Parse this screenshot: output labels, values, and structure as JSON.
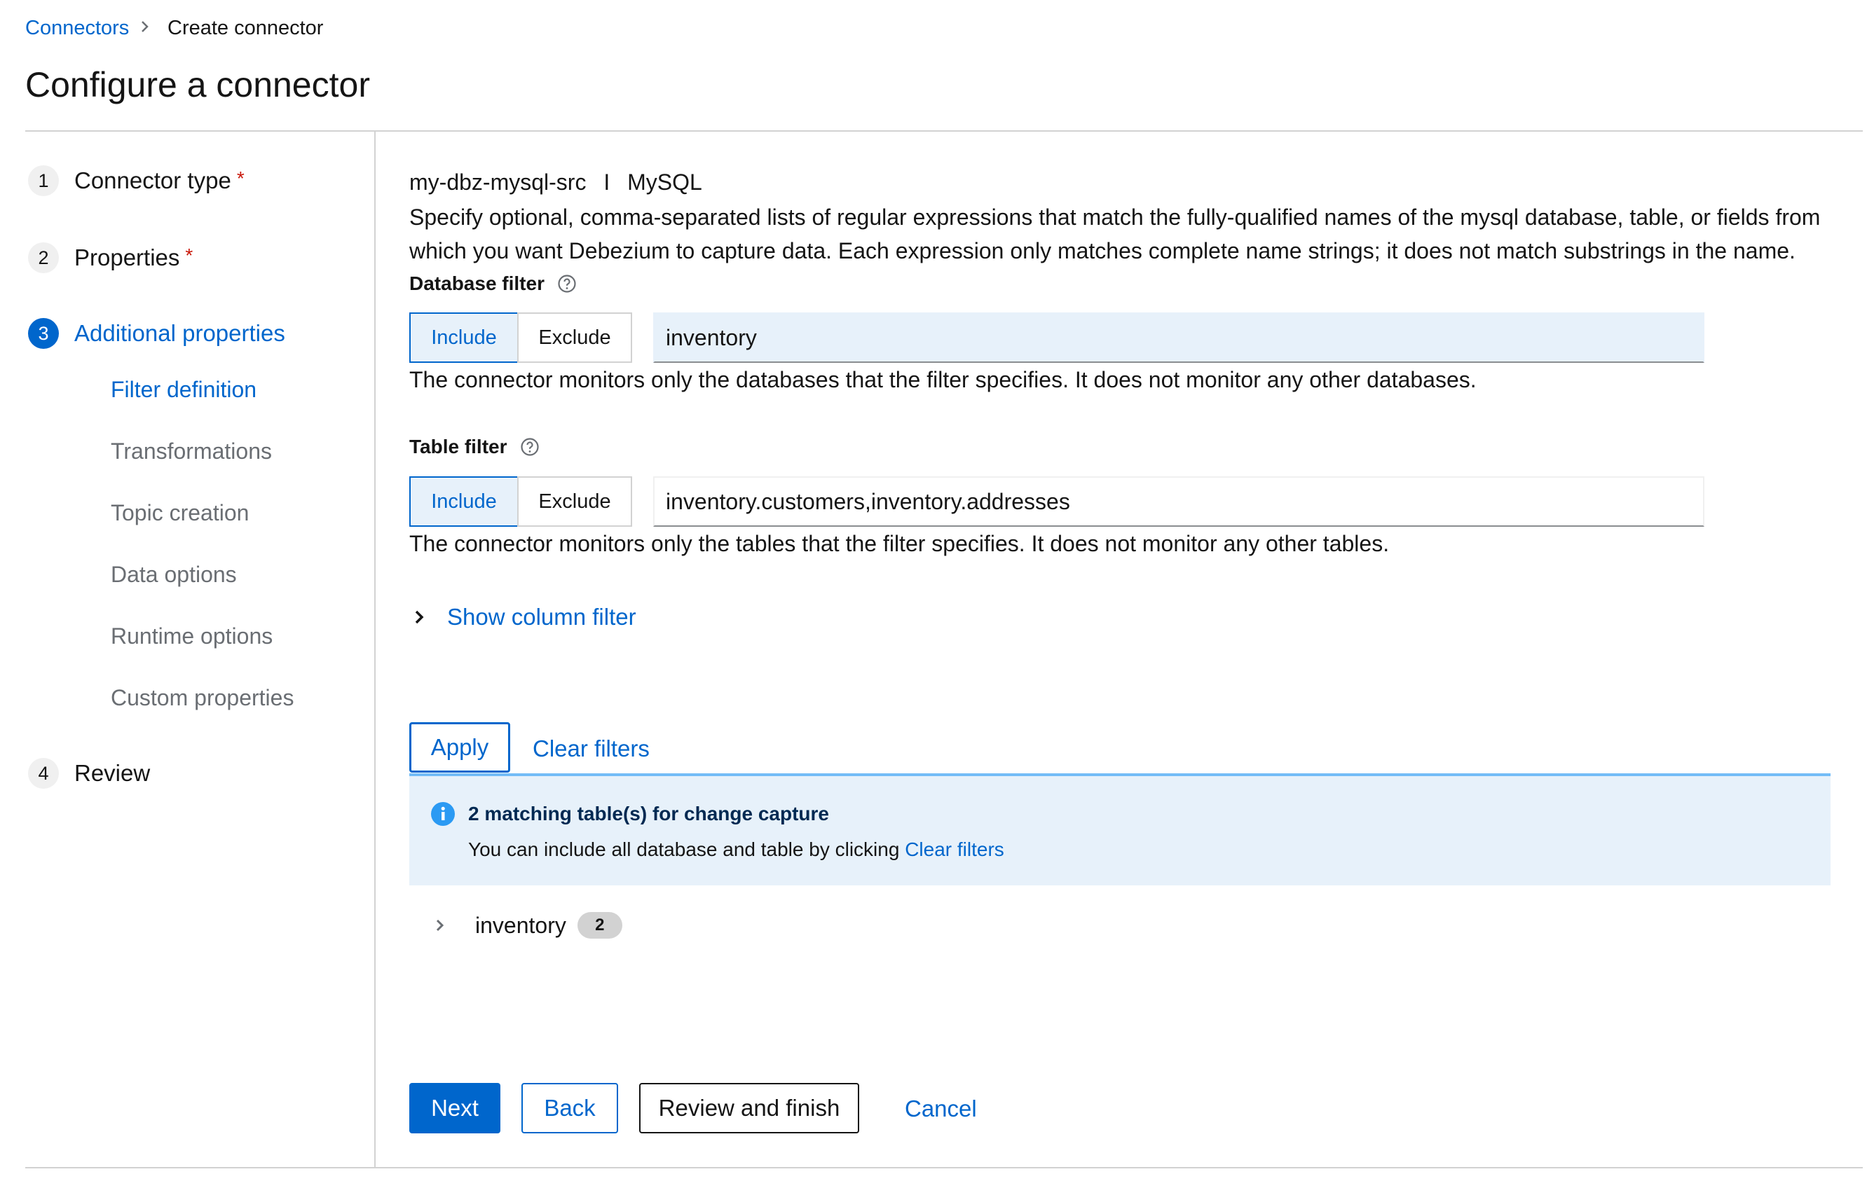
{
  "breadcrumb": {
    "parent": "Connectors",
    "current": "Create connector"
  },
  "page_title": "Configure a connector",
  "wizard": {
    "steps": [
      {
        "number": "1",
        "label": "Connector type",
        "required": "*"
      },
      {
        "number": "2",
        "label": "Properties",
        "required": "*"
      },
      {
        "number": "3",
        "label": "Additional properties"
      },
      {
        "number": "4",
        "label": "Review"
      }
    ],
    "substeps": [
      "Filter definition",
      "Transformations",
      "Topic creation",
      "Data options",
      "Runtime options",
      "Custom properties"
    ]
  },
  "connector": {
    "name": "my-dbz-mysql-src",
    "separator": "I",
    "type": "MySQL"
  },
  "description": "Specify optional, comma-separated lists of regular expressions that match the fully-qualified names of the mysql database, table, or fields from which you want Debezium to capture data. Each expression only matches complete name strings; it does not match substrings in the name.",
  "database_filter": {
    "label": "Database filter",
    "include_label": "Include",
    "exclude_label": "Exclude",
    "value": "inventory",
    "helper": "The connector monitors only the databases that the filter specifies. It does not monitor any other databases."
  },
  "table_filter": {
    "label": "Table filter",
    "include_label": "Include",
    "exclude_label": "Exclude",
    "value": "inventory.customers,inventory.addresses",
    "helper": "The connector monitors only the tables that the filter specifies. It does not monitor any other tables."
  },
  "column_filter": {
    "toggle_label": "Show column filter"
  },
  "actions": {
    "apply": "Apply",
    "clear": "Clear filters"
  },
  "alert": {
    "title": "2 matching table(s) for change capture",
    "body": "You can include all database and table by clicking",
    "link": "Clear filters"
  },
  "tree": {
    "label": "inventory",
    "count": "2"
  },
  "footer": {
    "next": "Next",
    "back": "Back",
    "review": "Review and finish",
    "cancel": "Cancel"
  },
  "colors": {
    "accent": "#0066cc",
    "info_bg": "#e7f1fa",
    "required": "#c9190b"
  }
}
